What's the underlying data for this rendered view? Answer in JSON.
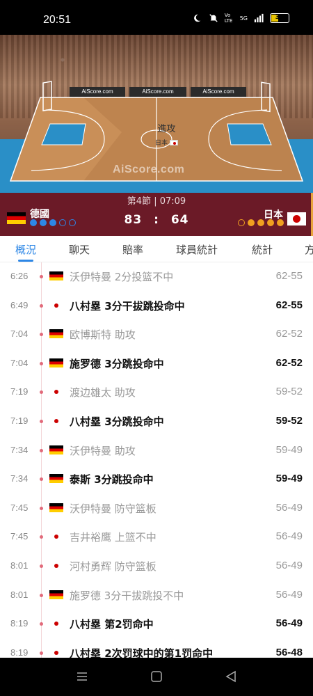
{
  "status_bar": {
    "time": "20:51",
    "battery": "39",
    "network": "5G",
    "volte": "Vo LTE"
  },
  "court": {
    "ads": [
      "AiScore.com",
      "AiScore.com",
      "AiScore.com"
    ],
    "attack_label": "進攻",
    "attack_team": "日本",
    "watermark": "AiScore.com"
  },
  "scoreboard": {
    "period": "第4節 | 07:09",
    "home": {
      "name": "德國",
      "score": "83",
      "timeouts_used": 3,
      "timeouts_total": 5
    },
    "away": {
      "name": "日本",
      "score": "64",
      "timeouts_used": 4,
      "timeouts_total": 5
    },
    "separator": ":",
    "colors": {
      "bar": "#6b1a27",
      "home_dot": "#2d87e6",
      "away_dot": "#f0a020"
    }
  },
  "tabs": [
    {
      "label": "概況",
      "active": true
    },
    {
      "label": "聊天",
      "active": false
    },
    {
      "label": "賠率",
      "active": false
    },
    {
      "label": "球員統計",
      "active": false
    },
    {
      "label": "統計",
      "active": false
    },
    {
      "label": "方",
      "active": false
    }
  ],
  "events": [
    {
      "time": "6:26",
      "team": "de",
      "text": "沃伊特曼 2分投篮不中",
      "score": "62-55",
      "bold": false
    },
    {
      "time": "6:49",
      "team": "jp",
      "text": "八村塁 3分干拔跳投命中",
      "score": "62-55",
      "bold": true
    },
    {
      "time": "7:04",
      "team": "de",
      "text": "欧博斯特 助攻",
      "score": "62-52",
      "bold": false
    },
    {
      "time": "7:04",
      "team": "de",
      "text": "施罗德 3分跳投命中",
      "score": "62-52",
      "bold": true
    },
    {
      "time": "7:19",
      "team": "jp",
      "text": "渡边雄太 助攻",
      "score": "59-52",
      "bold": false
    },
    {
      "time": "7:19",
      "team": "jp",
      "text": "八村塁 3分跳投命中",
      "score": "59-52",
      "bold": true
    },
    {
      "time": "7:34",
      "team": "de",
      "text": "沃伊特曼 助攻",
      "score": "59-49",
      "bold": false
    },
    {
      "time": "7:34",
      "team": "de",
      "text": "泰斯 3分跳投命中",
      "score": "59-49",
      "bold": true
    },
    {
      "time": "7:45",
      "team": "de",
      "text": "沃伊特曼 防守篮板",
      "score": "56-49",
      "bold": false
    },
    {
      "time": "7:45",
      "team": "jp",
      "text": "吉井裕鹰 上篮不中",
      "score": "56-49",
      "bold": false
    },
    {
      "time": "8:01",
      "team": "jp",
      "text": "河村勇辉 防守篮板",
      "score": "56-49",
      "bold": false
    },
    {
      "time": "8:01",
      "team": "de",
      "text": "施罗德 3分干拔跳投不中",
      "score": "56-49",
      "bold": false
    },
    {
      "time": "8:19",
      "team": "jp",
      "text": "八村塁 第2罚命中",
      "score": "56-49",
      "bold": true
    },
    {
      "time": "8:19",
      "team": "jp",
      "text": "八村塁 2次罚球中的第1罚命中",
      "score": "56-48",
      "bold": true
    }
  ]
}
